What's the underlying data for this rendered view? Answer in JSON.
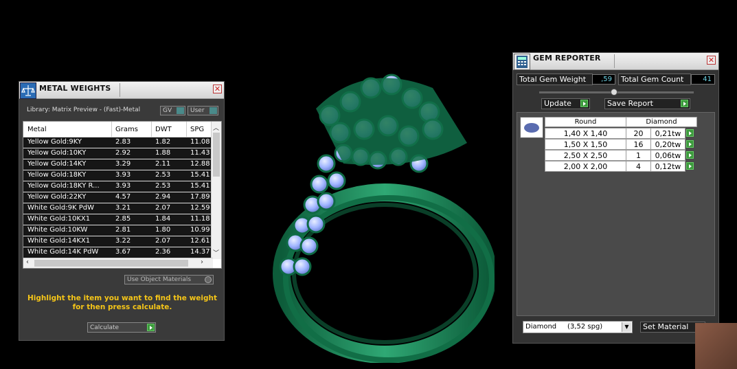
{
  "metal_weights": {
    "title": "METAL WEIGHTS",
    "library_label": "Library: Matrix Preview - (Fast)-Metal",
    "gv_label": "GV",
    "user_label": "User",
    "columns": [
      "Metal",
      "Grams",
      "DWT",
      "SPG"
    ],
    "rows": [
      [
        "Yellow Gold:9KY",
        "2.83",
        "1.82",
        "11.08"
      ],
      [
        "Yellow Gold:10KY",
        "2.92",
        "1.88",
        "11.43"
      ],
      [
        "Yellow Gold:14KY",
        "3.29",
        "2.11",
        "12.88"
      ],
      [
        "Yellow Gold:18KY",
        "3.93",
        "2.53",
        "15.41"
      ],
      [
        "Yellow Gold:18KY R...",
        "3.93",
        "2.53",
        "15.41"
      ],
      [
        "Yellow Gold:22KY",
        "4.57",
        "2.94",
        "17.89"
      ],
      [
        "White Gold:9K PdW",
        "3.21",
        "2.07",
        "12.59"
      ],
      [
        "White Gold:10KX1",
        "2.85",
        "1.84",
        "11.18"
      ],
      [
        "White Gold:10KW",
        "2.81",
        "1.80",
        "10.99"
      ],
      [
        "White Gold:14KX1",
        "3.22",
        "2.07",
        "12.61"
      ],
      [
        "White Gold:14K PdW",
        "3.67",
        "2.36",
        "14.37"
      ]
    ],
    "use_object_materials_label": "Use Object Materials",
    "hint_line1": "Highlight the item you want to find the weight",
    "hint_line2": "for then press calculate.",
    "calculate_label": "Calculate"
  },
  "gem_reporter": {
    "title": "GEM REPORTER",
    "total_weight_label": "Total Gem Weight",
    "total_weight_value": ",59",
    "total_count_label": "Total Gem Count",
    "total_count_value": "41",
    "update_label": "Update",
    "save_report_label": "Save Report",
    "shape_header": "Round",
    "material_header": "Diamond",
    "rows": [
      {
        "size": "1,40 X 1,40",
        "count": "20",
        "weight": "0,21tw"
      },
      {
        "size": "1,50 X 1,50",
        "count": "16",
        "weight": "0,20tw"
      },
      {
        "size": "2,50 X 2,50",
        "count": "1",
        "weight": "0,06tw"
      },
      {
        "size": "2,00 X 2,00",
        "count": "4",
        "weight": "0,12tw"
      }
    ],
    "material_select": "Diamond     (3,52 spg)",
    "set_material_label": "Set Material"
  },
  "colors": {
    "metal": "#1f8a5c",
    "gem": "#9fb4ff",
    "hint": "#f5c518",
    "value_text": "#6fd6e8"
  },
  "icons": {
    "metal_panel_icon": "scale-icon",
    "gem_panel_icon": "calculator-icon",
    "close": "close-icon",
    "go": "play-arrow-icon"
  }
}
